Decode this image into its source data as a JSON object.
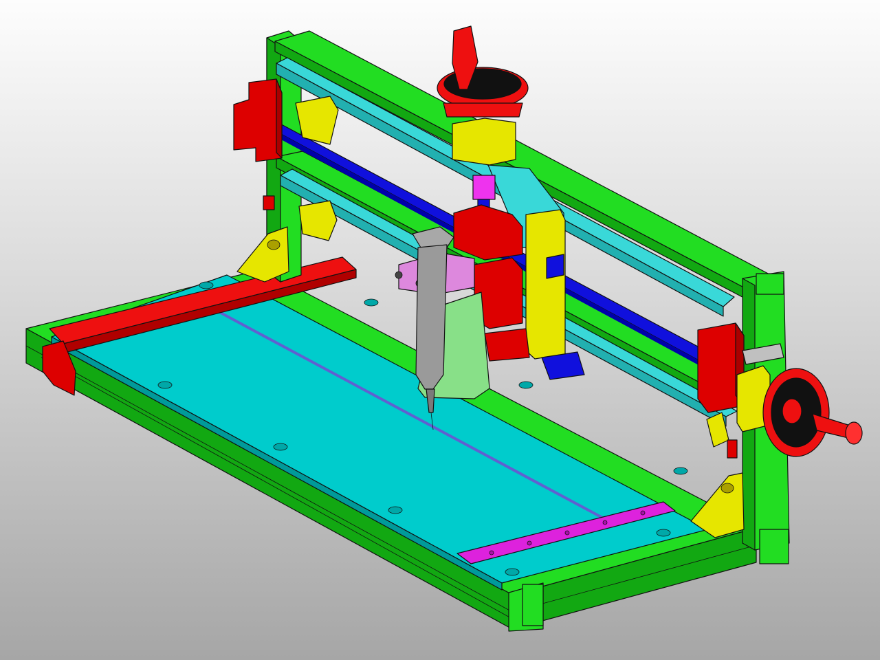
{
  "scene": {
    "background_top": "#fdfdfd",
    "background_bottom": "#a6a6a6"
  },
  "colors": {
    "frame": "#22dd22",
    "frame_dark": "#12a812",
    "table": "#00cccc",
    "table_dark": "#009a9a",
    "rail": "#39d8d8",
    "rod": "#1010dd",
    "block": "#dd0000",
    "bracket": "#e6e600",
    "magenta": "#cc22cc",
    "lavender": "#dd88dd",
    "syringe": "#9a9a9a",
    "shield": "#88e088",
    "pink": "#ee33ee",
    "slot": "#6060d0"
  },
  "parts": [
    {
      "id": "base-frame",
      "icon": "aluminum-profile-frame-icon"
    },
    {
      "id": "work-table",
      "icon": "plate-icon"
    },
    {
      "id": "gantry",
      "icon": "gantry-icon"
    },
    {
      "id": "linear-rails",
      "icon": "rail-icon"
    },
    {
      "id": "lead-screw",
      "icon": "rod-icon"
    },
    {
      "id": "handwheel-x",
      "icon": "handwheel-icon"
    },
    {
      "id": "handwheel-z",
      "icon": "handwheel-icon"
    },
    {
      "id": "dispenser-syringe",
      "icon": "syringe-icon"
    },
    {
      "id": "left-fence",
      "icon": "fence-icon"
    },
    {
      "id": "front-ruler",
      "icon": "ruler-icon"
    }
  ]
}
